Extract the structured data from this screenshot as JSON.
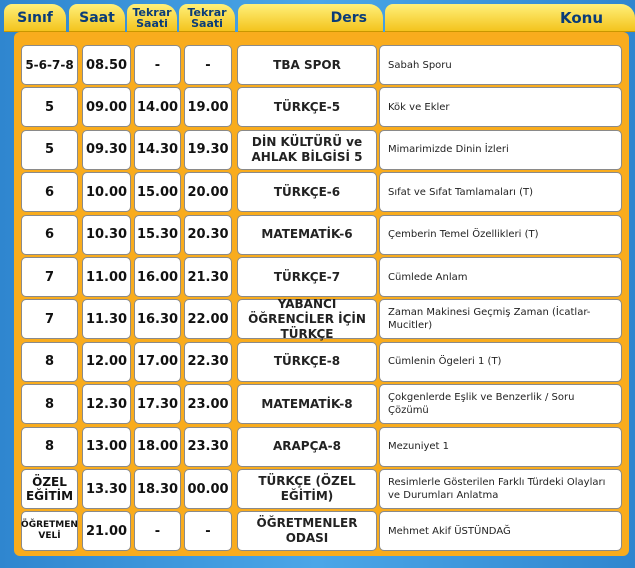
{
  "header": {
    "sinif": "Sınıf",
    "saat": "Saat",
    "tekrar1": "Tekrar Saati",
    "tekrar2": "Tekrar Saati",
    "ders": "Ders",
    "konu": "Konu"
  },
  "rows": [
    {
      "sinif": "5-6-7-8",
      "saat": "08.50",
      "tekrar1": "-",
      "tekrar2": "-",
      "ders": "TBA SPOR",
      "konu": "Sabah Sporu"
    },
    {
      "sinif": "5",
      "saat": "09.00",
      "tekrar1": "14.00",
      "tekrar2": "19.00",
      "ders": "TÜRKÇE-5",
      "konu": "Kök ve Ekler"
    },
    {
      "sinif": "5",
      "saat": "09.30",
      "tekrar1": "14.30",
      "tekrar2": "19.30",
      "ders": "DİN KÜLTÜRÜ ve AHLAK BİLGİSİ 5",
      "konu": "Mimarimizde Dinin İzleri"
    },
    {
      "sinif": "6",
      "saat": "10.00",
      "tekrar1": "15.00",
      "tekrar2": "20.00",
      "ders": "TÜRKÇE-6",
      "konu": "Sıfat ve Sıfat Tamlamaları (T)"
    },
    {
      "sinif": "6",
      "saat": "10.30",
      "tekrar1": "15.30",
      "tekrar2": "20.30",
      "ders": "MATEMATİK-6",
      "konu": "Çemberin Temel Özellikleri (T)"
    },
    {
      "sinif": "7",
      "saat": "11.00",
      "tekrar1": "16.00",
      "tekrar2": "21.30",
      "ders": "TÜRKÇE-7",
      "konu": "Cümlede Anlam"
    },
    {
      "sinif": "7",
      "saat": "11.30",
      "tekrar1": "16.30",
      "tekrar2": "22.00",
      "ders": "YABANCI ÖĞRENCİLER İÇİN TÜRKÇE",
      "konu": "Zaman Makinesi Geçmiş Zaman (İcatlar-Mucitler)"
    },
    {
      "sinif": "8",
      "saat": "12.00",
      "tekrar1": "17.00",
      "tekrar2": "22.30",
      "ders": "TÜRKÇE-8",
      "konu": "Cümlenin Ögeleri 1 (T)"
    },
    {
      "sinif": "8",
      "saat": "12.30",
      "tekrar1": "17.30",
      "tekrar2": "23.00",
      "ders": "MATEMATİK-8",
      "konu": "Çokgenlerde Eşlik ve Benzerlik / Soru Çözümü"
    },
    {
      "sinif": "8",
      "saat": "13.00",
      "tekrar1": "18.00",
      "tekrar2": "23.30",
      "ders": "ARAPÇA-8",
      "konu": "Mezuniyet 1"
    },
    {
      "sinif": "ÖZEL EĞİTİM",
      "saat": "13.30",
      "tekrar1": "18.30",
      "tekrar2": "00.00",
      "ders": "TÜRKÇE (ÖZEL EĞİTİM)",
      "konu": "Resimlerle Gösterilen Farklı Türdeki Olayları ve Durumları Anlatma"
    },
    {
      "sinif": "ÖĞRETMEN VELİ",
      "saat": "21.00",
      "tekrar1": "-",
      "tekrar2": "-",
      "ders": "ÖĞRETMENLER ODASI",
      "konu": "Mehmet Akif ÜSTÜNDAĞ"
    }
  ]
}
